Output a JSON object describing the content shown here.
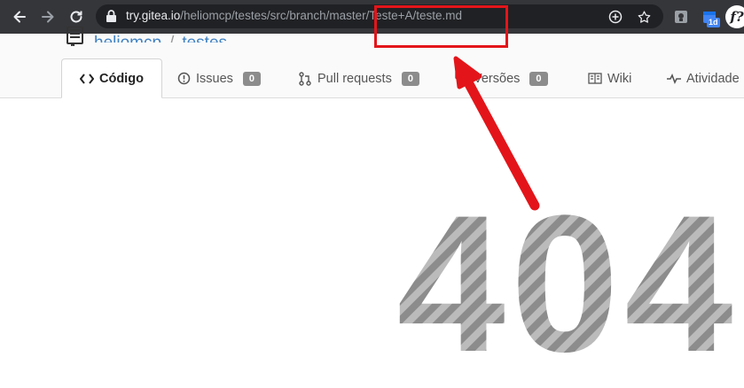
{
  "browser": {
    "url_host": "try.gitea.io",
    "url_path": "/heliomcp/testes/src/branch/master/Teste+A/teste.md",
    "extension_badge": "1d",
    "profile_initial": "f?",
    "icons": [
      "back-arrow-icon",
      "forward-arrow-icon",
      "reload-icon",
      "lock-icon",
      "add-circle-icon",
      "star-icon",
      "extension-icon",
      "calendar-extension-icon"
    ]
  },
  "repo": {
    "owner": "heliomcp",
    "separator": "/",
    "name": "testes"
  },
  "tabs": [
    {
      "label": "Código",
      "icon": "code-icon",
      "active": true
    },
    {
      "label": "Issues",
      "icon": "issue-icon",
      "count": "0"
    },
    {
      "label": "Pull requests",
      "icon": "pull-request-icon",
      "count": "0"
    },
    {
      "label": "Versões",
      "icon": "tag-icon",
      "count": "0"
    },
    {
      "label": "Wiki",
      "icon": "book-icon"
    },
    {
      "label": "Atividade",
      "icon": "pulse-icon"
    }
  ],
  "error": {
    "code": "404"
  },
  "annotation": {
    "highlight_color": "#e3151a",
    "target": "url-path-highlight"
  },
  "colors": {
    "chrome": "#35363a",
    "omnibox": "#202124",
    "link": "#4183c4",
    "badge": "#8c8c8c"
  }
}
